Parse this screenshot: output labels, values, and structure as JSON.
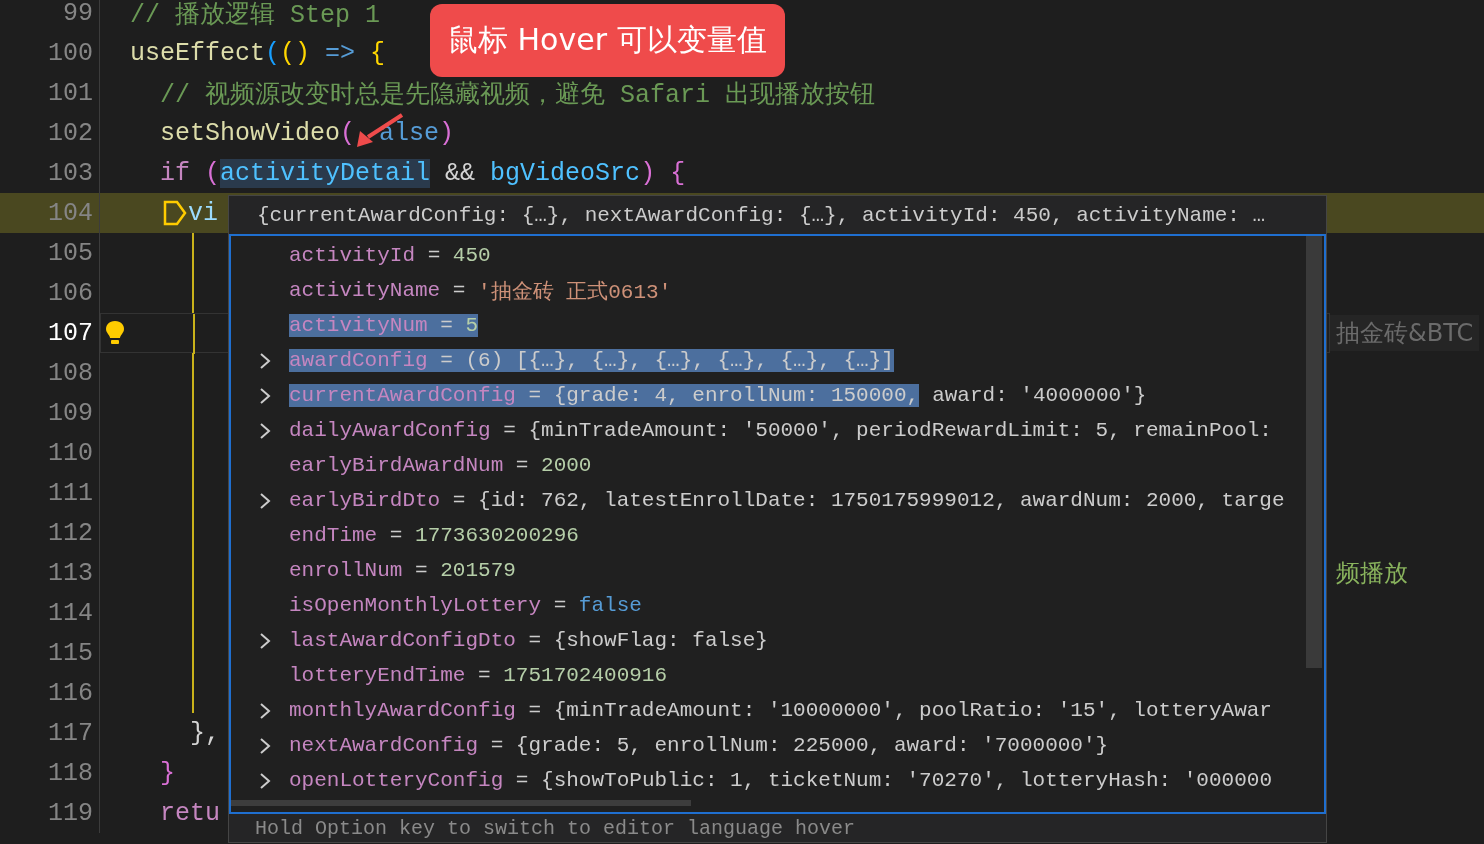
{
  "editor": {
    "lines": [
      {
        "number": "99",
        "tokens": [
          {
            "kind": "comment",
            "text": "// 播放逻辑 Step 1"
          }
        ]
      },
      {
        "number": "100",
        "tokens": [
          {
            "kind": "function",
            "text": "useEffect"
          },
          {
            "kind": "bracket-blue",
            "text": "("
          },
          {
            "kind": "bracket-yellow",
            "text": "()"
          },
          {
            "kind": "keyword-blue",
            "text": " =>"
          },
          {
            "kind": "bracket-yellow",
            "text": " {"
          }
        ]
      },
      {
        "number": "101",
        "tokens": [
          {
            "kind": "comment",
            "text": "  // 视频源改变时总是先隐藏视频，避免 Safari 出现播放按钮"
          }
        ]
      },
      {
        "number": "102",
        "tokens": [
          {
            "kind": "function",
            "text": "  setShowVideo"
          },
          {
            "kind": "bracket-purple",
            "text": "("
          },
          {
            "kind": "covered-keyword",
            "text": "alse"
          },
          {
            "kind": "bracket-purple",
            "text": ")"
          }
        ]
      },
      {
        "number": "103",
        "tokens": [
          {
            "kind": "keyword",
            "text": "  if"
          },
          {
            "kind": "bracket-purple",
            "text": " ("
          },
          {
            "kind": "hovered-variable",
            "text": "activityDetail"
          },
          {
            "kind": "plain",
            "text": " &&"
          },
          {
            "kind": "variable",
            "text": " bgVideoSrc"
          },
          {
            "kind": "bracket-purple",
            "text": ")"
          },
          {
            "kind": "bracket-purple",
            "text": " {"
          }
        ]
      },
      {
        "number": "104",
        "paused": true,
        "tokens": [
          {
            "kind": "stop-marker"
          },
          {
            "kind": "variable-light",
            "text": "vi"
          }
        ]
      },
      {
        "number": "105",
        "guide": true
      },
      {
        "number": "106",
        "guide": true
      },
      {
        "number": "107",
        "current": true,
        "lightbulb": true,
        "guide": true,
        "right_text": {
          "kind": "inline-hint",
          "text": "抽金砖&BTC"
        }
      },
      {
        "number": "108",
        "guide": true
      },
      {
        "number": "109",
        "guide": true
      },
      {
        "number": "110",
        "guide": true
      },
      {
        "number": "111",
        "guide": true
      },
      {
        "number": "112",
        "guide": true
      },
      {
        "number": "113",
        "guide": true,
        "right_text": {
          "kind": "comment",
          "text": "频播放"
        }
      },
      {
        "number": "114",
        "guide": true
      },
      {
        "number": "115",
        "guide": true
      },
      {
        "number": "116",
        "guide": true
      },
      {
        "number": "117",
        "tokens": [
          {
            "kind": "plain",
            "text": "    },"
          }
        ]
      },
      {
        "number": "118",
        "tokens": [
          {
            "kind": "bracket-purple",
            "text": "  }"
          }
        ]
      },
      {
        "number": "119",
        "tokens": [
          {
            "kind": "keyword",
            "text": "  retu"
          }
        ]
      }
    ]
  },
  "hover": {
    "summary": "{currentAwardConfig: {…}, nextAwardConfig: {…}, activityId: 450, activityName: …",
    "rows": [
      {
        "name": "activityId",
        "separator": "=",
        "value": "450",
        "kind": "number",
        "expandable": false,
        "selected": false
      },
      {
        "name": "activityName",
        "separator": "=",
        "value": "'抽金砖 正式0613'",
        "kind": "string",
        "expandable": false,
        "selected": false
      },
      {
        "name": "activityNum",
        "separator": "=",
        "value": "5",
        "kind": "number",
        "expandable": false,
        "selected": true
      },
      {
        "name": "awardConfig",
        "separator": "=",
        "value": "(6) [{…}, {…}, {…}, {…}, {…}, {…}]",
        "kind": "object",
        "expandable": true,
        "selected": true
      },
      {
        "name": "currentAwardConfig",
        "separator": "=",
        "value": "{grade: 4, enrollNum: 150000,",
        "value_tail": "award: '4000000'}",
        "kind": "object",
        "expandable": true,
        "selected": true
      },
      {
        "name": "dailyAwardConfig",
        "separator": "=",
        "value": "{minTradeAmount: '50000', periodRewardLimit: 5, remainPool:",
        "kind": "object",
        "expandable": true,
        "selected": false
      },
      {
        "name": "earlyBirdAwardNum",
        "separator": "=",
        "value": "2000",
        "kind": "number",
        "expandable": false,
        "selected": false
      },
      {
        "name": "earlyBirdDto",
        "separator": "=",
        "value": "{id: 762, latestEnrollDate: 1750175999012, awardNum: 2000, targe",
        "kind": "object",
        "expandable": true,
        "selected": false
      },
      {
        "name": "endTime",
        "separator": "=",
        "value": "1773630200296",
        "kind": "number",
        "expandable": false,
        "selected": false
      },
      {
        "name": "enrollNum",
        "separator": "=",
        "value": "201579",
        "kind": "number",
        "expandable": false,
        "selected": false
      },
      {
        "name": "isOpenMonthlyLottery",
        "separator": "=",
        "value": "false",
        "kind": "boolean",
        "expandable": false,
        "selected": false
      },
      {
        "name": "lastAwardConfigDto",
        "separator": "=",
        "value": "{showFlag: false}",
        "kind": "object",
        "expandable": true,
        "selected": false
      },
      {
        "name": "lotteryEndTime",
        "separator": "=",
        "value": "1751702400916",
        "kind": "number",
        "expandable": false,
        "selected": false
      },
      {
        "name": "monthlyAwardConfig",
        "separator": "=",
        "value": "{minTradeAmount: '10000000', poolRatio: '15', lotteryAwar",
        "kind": "object",
        "expandable": true,
        "selected": false
      },
      {
        "name": "nextAwardConfig",
        "separator": "=",
        "value": "{grade: 5, enrollNum: 225000, award: '7000000'}",
        "kind": "object",
        "expandable": true,
        "selected": false
      },
      {
        "name": "openLotteryConfig",
        "separator": "=",
        "value": "{showToPublic: 1, ticketNum: '70270', lotteryHash: '000000",
        "kind": "object",
        "expandable": true,
        "selected": false
      }
    ],
    "footer": "Hold Option key to switch to editor language hover"
  },
  "annotation": {
    "text": "鼠标 Hover 可以变量值"
  }
}
